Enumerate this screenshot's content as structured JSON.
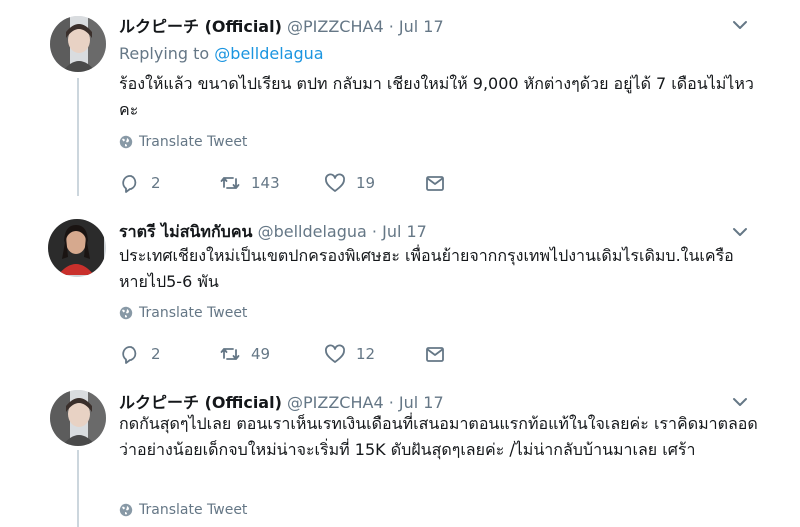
{
  "tweets": [
    {
      "name": "ルクピーチ (Official)",
      "handle": "@PIZZCHA4",
      "date": "Jul 17",
      "replying_label": "Replying to",
      "replying_handle": "@belldelagua",
      "text": "ร้องให้แล้ว ขนาดไปเรียน ตปท กลับมา เชียงใหม่ให้ 9,000 หักต่างๆด้วย อยู่ได้ 7 เดือนไม่ไหวคะ",
      "translate": "Translate Tweet",
      "replies": "2",
      "retweets": "143",
      "likes": "19"
    },
    {
      "name": "ราตรี ไม่สนิทกับคน",
      "handle": "@belldelagua",
      "date": "Jul 17",
      "text": "ประเทศเชียงใหม่เป็นเขตปกครองพิเศษฮะ เพื่อนย้ายจากกรุงเทพไปงานเดิมไรเดิมบ.ในเครือ หายไป5-6 พัน",
      "translate": "Translate Tweet",
      "replies": "2",
      "retweets": "49",
      "likes": "12"
    },
    {
      "name": "ルクピーチ (Official)",
      "handle": "@PIZZCHA4",
      "date": "Jul 17",
      "text": "กดกันสุดๆไปเลย ตอนเราเห็นเรทเงินเดือนที่เสนอมาตอนแรกท้อแท้ในใจเลยค่ะ เราคิดมาตลอดว่าอย่างน้อยเด็กจบใหม่น่าจะเริ่มที่ 15K ดับฝันสุดๆเลยค่ะ /ไม่น่ากลับบ้านมาเลย เศร้า",
      "translate": "Translate Tweet"
    }
  ],
  "sep": "·",
  "icons": [
    "reply-icon",
    "retweet-icon",
    "like-icon",
    "dm-icon",
    "globe-icon",
    "chevron-down-icon"
  ]
}
